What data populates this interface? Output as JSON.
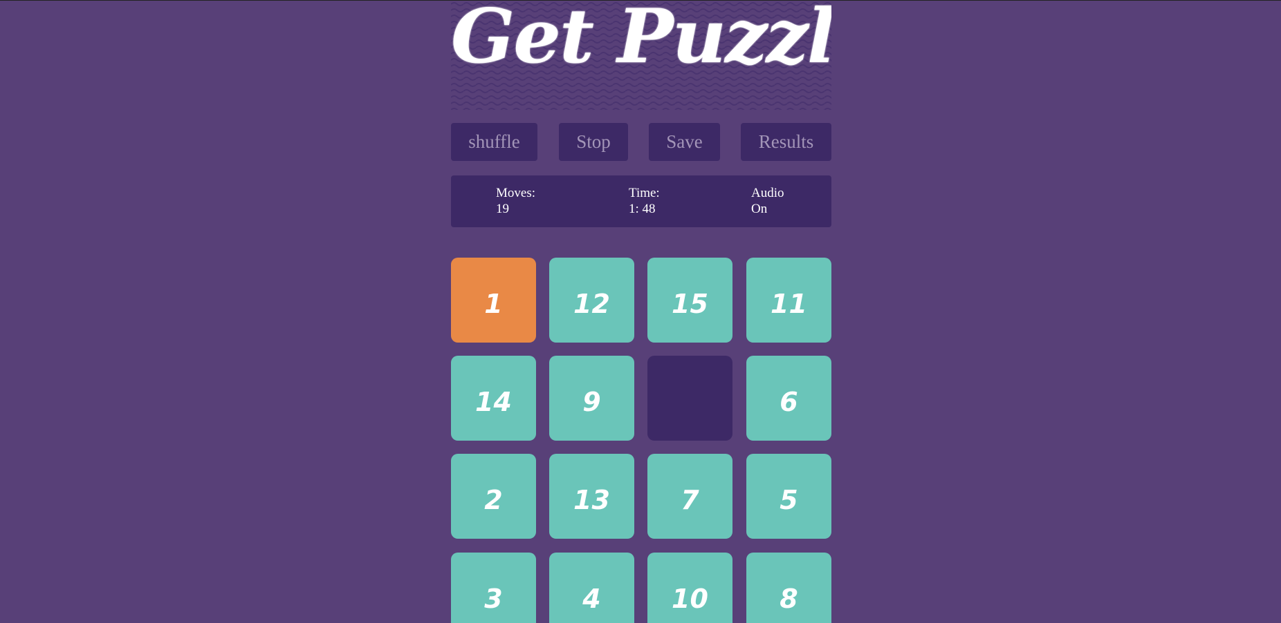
{
  "header": {
    "title": "Get Puzzle"
  },
  "controls": {
    "shuffle_label": "shuffle",
    "stop_label": "Stop",
    "save_label": "Save",
    "results_label": "Results"
  },
  "stats": {
    "moves_label": "Moves:",
    "moves_value": "19",
    "time_label": "Time:",
    "time_value": "1: 48",
    "audio_label": "Audio",
    "audio_value": "On"
  },
  "board": {
    "rows": [
      [
        "1",
        "12",
        "15",
        "11"
      ],
      [
        "14",
        "9",
        "",
        "6"
      ],
      [
        "2",
        "13",
        "7",
        "5"
      ],
      [
        "3",
        "4",
        "10",
        "8"
      ]
    ],
    "highlighted_tile": "1",
    "empty_tile_position": {
      "row": 2,
      "column": 3
    }
  },
  "colors": {
    "background": "#584078",
    "panel": "#3d2966",
    "tile": "#6ac5b9",
    "tile_highlight": "#e98946",
    "button_text": "#a395b8",
    "text": "#ffffff"
  }
}
